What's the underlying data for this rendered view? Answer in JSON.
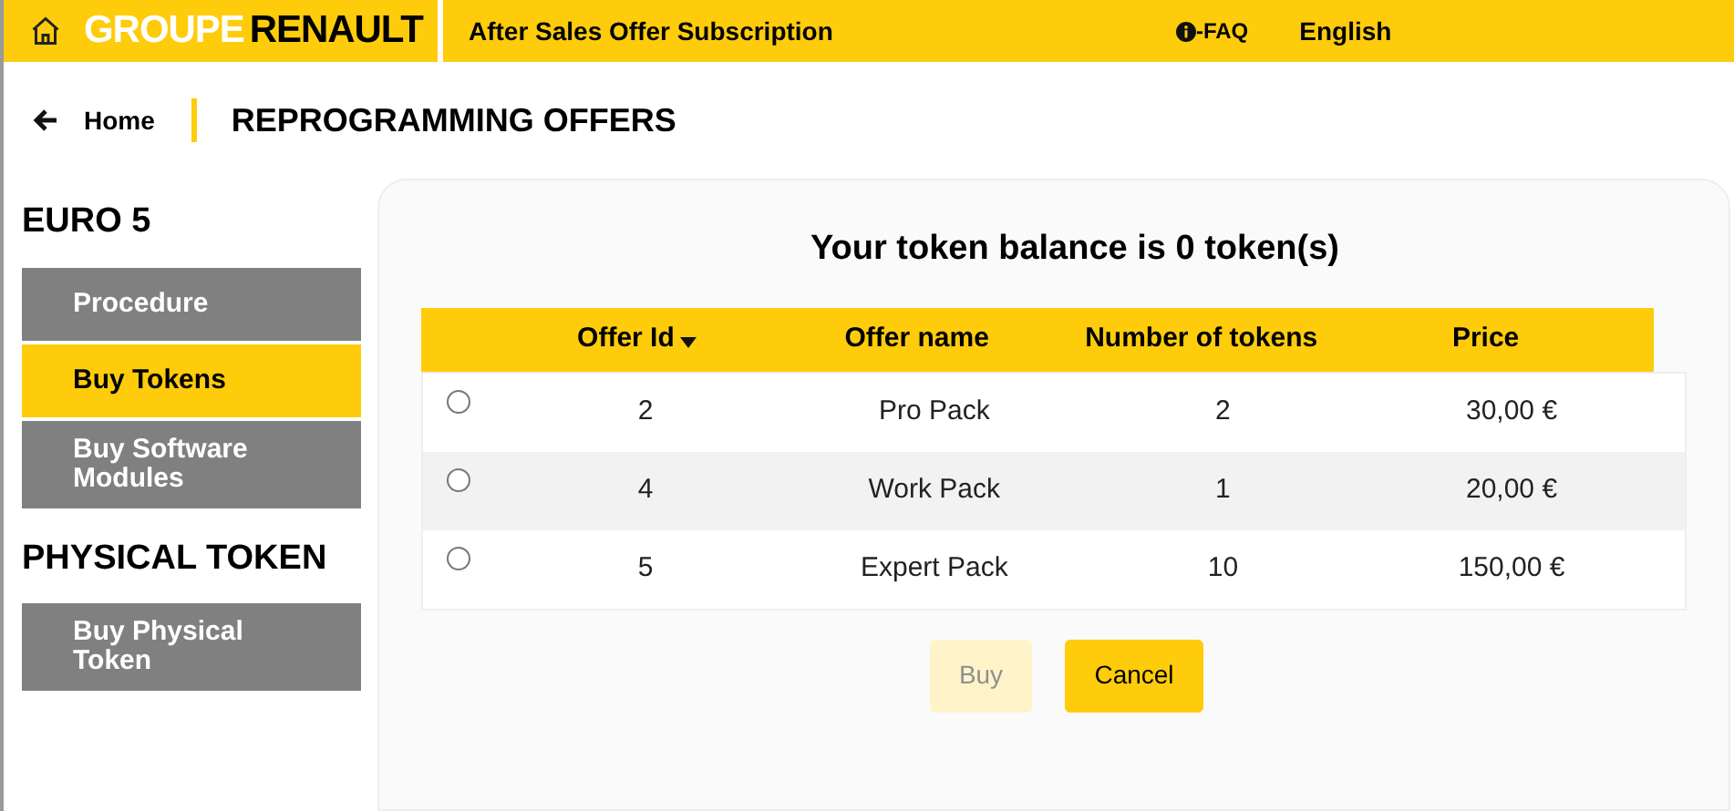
{
  "header": {
    "brand_light": "GROUPE",
    "brand_dark": "RENAULT",
    "title": "After Sales Offer Subscription",
    "faq": "-FAQ",
    "language": "English"
  },
  "breadcrumb": {
    "home": "Home",
    "title": "REPROGRAMMING OFFERS"
  },
  "sidebar": [
    {
      "heading": "EURO 5",
      "items": [
        {
          "label": "Procedure",
          "selected": false
        },
        {
          "label": "Buy Tokens",
          "selected": true
        },
        {
          "label": "Buy Software Modules",
          "selected": false
        }
      ]
    },
    {
      "heading": "PHYSICAL TOKEN",
      "items": [
        {
          "label": "Buy Physical Token",
          "selected": false
        }
      ]
    }
  ],
  "balance": "Your token balance is 0 token(s)",
  "table": {
    "columns": [
      {
        "label": "Offer Id",
        "sorted": true
      },
      {
        "label": "Offer name",
        "sorted": false
      },
      {
        "label": "Number of tokens",
        "sorted": false
      },
      {
        "label": "Price",
        "sorted": false
      }
    ],
    "rows": [
      {
        "selected": false,
        "cells": [
          "2",
          "Pro Pack",
          "2",
          "30,00 €"
        ]
      },
      {
        "selected": false,
        "cells": [
          "4",
          "Work Pack",
          "1",
          "20,00 €"
        ]
      },
      {
        "selected": false,
        "cells": [
          "5",
          "Expert Pack",
          "10",
          "150,00 €"
        ]
      }
    ]
  },
  "buttons": [
    {
      "label": "Buy",
      "disabled": true
    },
    {
      "label": "Cancel",
      "disabled": false
    }
  ]
}
